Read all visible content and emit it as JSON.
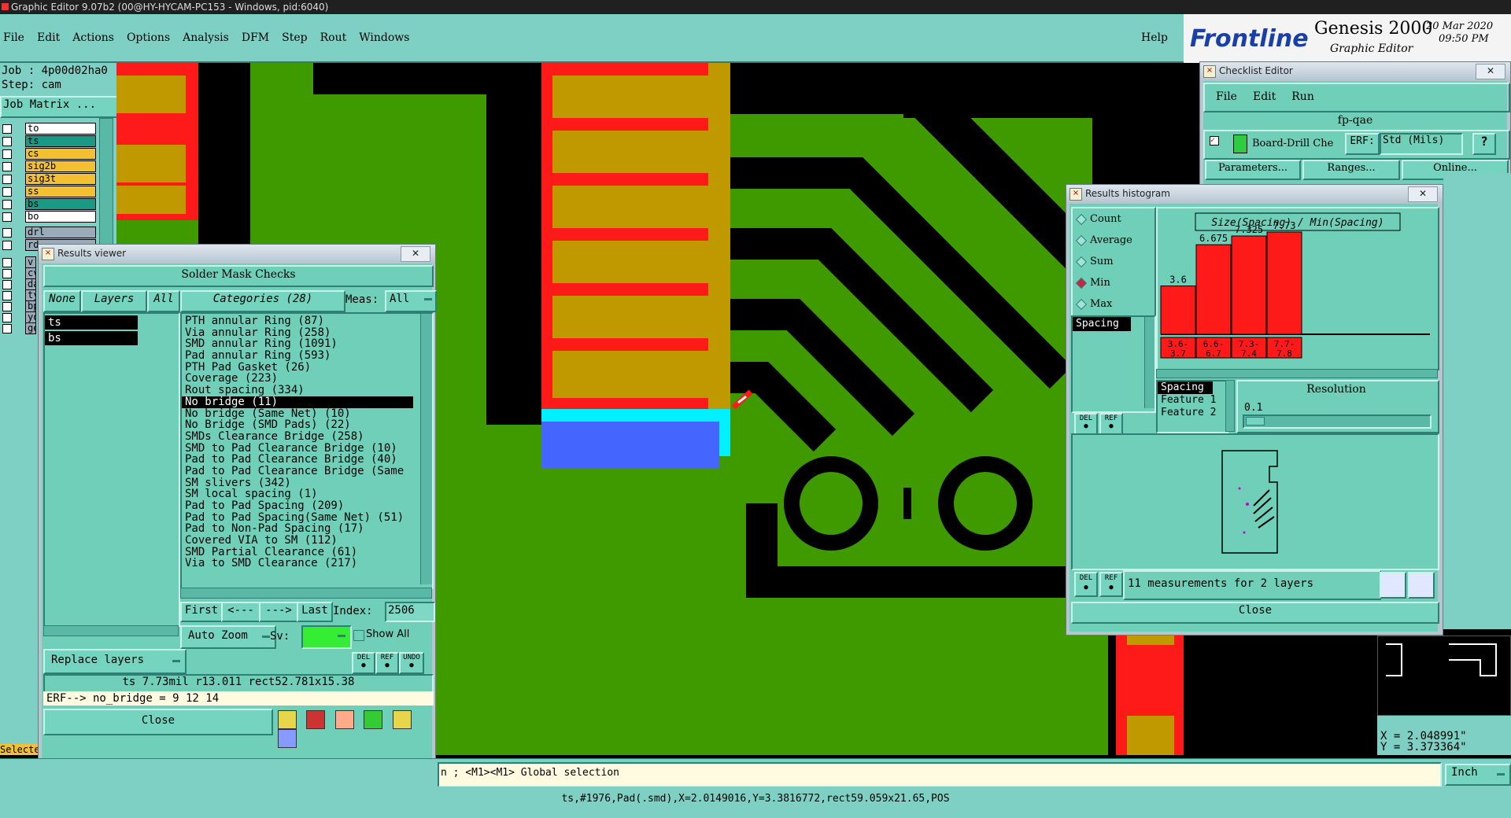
{
  "window_title": "Graphic Editor 9.07b2 (00@HY-HYCAM-PC153 - Windows, pid:6040)",
  "menu": [
    "File",
    "Edit",
    "Actions",
    "Options",
    "Analysis",
    "DFM",
    "Step",
    "Rout",
    "Windows"
  ],
  "help_label": "Help",
  "brand": {
    "logo": "Frontline",
    "product": "Genesis 2000",
    "subtitle": "Graphic Editor",
    "date": "20 Mar 2020",
    "time": "09:50 PM"
  },
  "job": {
    "job": "Job : 4p00d02ha0",
    "step": "Step: cam",
    "matrix": "Job Matrix ..."
  },
  "layers": [
    {
      "name": "to",
      "color": "#ffffff"
    },
    {
      "name": "ts",
      "color": "#1a9a84"
    },
    {
      "name": "cs",
      "color": "#f2c030"
    },
    {
      "name": "sig2b",
      "color": "#f2c030"
    },
    {
      "name": "sig3t",
      "color": "#f2c030"
    },
    {
      "name": "ss",
      "color": "#f2c030"
    },
    {
      "name": "bs",
      "color": "#1a9a84"
    },
    {
      "name": "bo",
      "color": "#ffffff"
    }
  ],
  "layers2": [
    {
      "name": "drl"
    },
    {
      "name": "rd"
    }
  ],
  "layers3": [
    "v",
    "cv",
    "da",
    "ty",
    "bp",
    "yo",
    "ge"
  ],
  "selected_label": "Selecte",
  "results_viewer": {
    "title": "Results viewer",
    "header": "Solder Mask Checks",
    "btn_none": "None",
    "btn_layers": "Layers",
    "btn_all": "All",
    "categories_label": "Categories (28)",
    "meas_label": "Meas:",
    "meas_value": "All",
    "layer_list": [
      "ts",
      "bs"
    ],
    "categories": [
      "PTH annular Ring (87)",
      "Via annular Ring (258)",
      "SMD annular Ring (1091)",
      "Pad annular Ring (593)",
      "PTH Pad Gasket (26)",
      "Coverage (223)",
      "Rout spacing (334)",
      "No bridge (11)",
      "No bridge (Same Net) (10)",
      "No Bridge (SMD Pads) (22)",
      "SMDs Clearance Bridge (258)",
      "SMD to Pad Clearance Bridge (10)",
      "Pad to Pad Clearance Bridge (40)",
      "Pad to Pad Clearance Bridge (Same",
      "SM slivers (342)",
      "SM local spacing (1)",
      "Pad to Pad Spacing (209)",
      "Pad to Pad Spacing(Same Net) (51)",
      "Pad to Non-Pad Spacing (17)",
      "Covered VIA to SM (112)",
      "SMD Partial Clearance (61)",
      "Via to SMD Clearance (217)"
    ],
    "selected_index": 7,
    "nav": {
      "first": "First",
      "prev": "<---",
      "next": "--->",
      "last": "Last",
      "index_label": "Index:",
      "index_value": "2506"
    },
    "auto_zoom": "Auto Zoom",
    "sv_label": "Sv:",
    "show_all": "Show All",
    "replace_layers": "Replace layers",
    "status": "ts 7.73mil  r13.011  rect52.781x15.38",
    "erf": "ERF--> no_bridge = 9 12 14",
    "close": "Close"
  },
  "checklist": {
    "title": "Checklist Editor",
    "menu": [
      "File",
      "Edit",
      "Run"
    ],
    "name": "fp-qae",
    "item": "Board-Drill Che",
    "erf_label": "ERF:",
    "erf_value": "Std (Mils)",
    "parameters": "Parameters...",
    "ranges": "Ranges...",
    "online": "Online..."
  },
  "histogram": {
    "title": "Results histogram",
    "options": [
      "Count",
      "Average",
      "Sum",
      "Min",
      "Max"
    ],
    "selected_option": "Min",
    "measure": "Spacing",
    "chart_title": "Size(Spacing) / Min(Spacing)",
    "resolution_label": "Resolution",
    "resolution_value": "0.1",
    "field_list": [
      "Spacing",
      "Feature 1",
      "Feature 2"
    ],
    "measurements": "11 measurements for 2 layers",
    "close": "Close"
  },
  "chart_data": {
    "type": "bar",
    "title": "Size(Spacing) / Min(Spacing)",
    "categories": [
      "3.6-3.7",
      "6.6-6.7",
      "7.3-7.4",
      "7.7-7.8"
    ],
    "values": [
      3.6,
      6.675,
      7.325,
      7.73
    ],
    "value_labels": [
      "3.6",
      "6.675",
      "7.325",
      "7.73"
    ],
    "bin_labels_top": [
      "3.6-",
      "6.6-",
      "7.3-",
      "7.7-"
    ],
    "bin_labels_bottom": [
      "3.7",
      "6.7",
      "7.4",
      "7.8"
    ],
    "ylim": [
      0,
      8
    ],
    "bar_color": "#ff1a1a"
  },
  "coords": {
    "x": "X = 2.048991\"",
    "y": "Y = 3.373364\""
  },
  "prompt": "n ; <M1><M1> Global selection",
  "units": "Inch",
  "bottom_status": "ts,#1976,Pad(.smd),X=2.0149016,Y=3.3816772,rect59.059x21.65,POS",
  "colors": {
    "pcb_green": "#3f9a00",
    "pad_gold": "#c09800",
    "mask_red": "#ff1a1a",
    "highlight_blue": "#4466ff",
    "cyan": "#00f0ff",
    "ui_teal": "#7fd0c4"
  }
}
